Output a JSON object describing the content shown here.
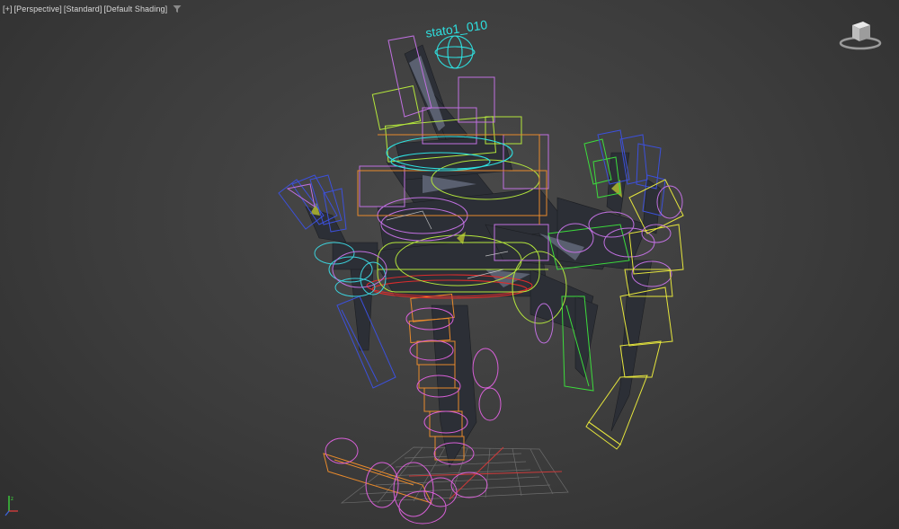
{
  "viewport": {
    "labels": [
      "[+]",
      "[Perspective]",
      "[Standard]",
      "[Default Shading]"
    ],
    "object_label": "stato1_010",
    "colors": {
      "background": "#3c3c3c",
      "cyan": "#2ee0e0",
      "lime": "#b4e63c",
      "magenta": "#d860d8",
      "orange": "#e88a2c",
      "yellow": "#e6e63c",
      "blue": "#3c50dc",
      "green": "#3cdc3c",
      "red": "#dc2c2c",
      "grid": "#6e6e6e"
    }
  },
  "icons": [
    "filter-icon",
    "viewcube-icon",
    "axis-tripod-icon"
  ]
}
